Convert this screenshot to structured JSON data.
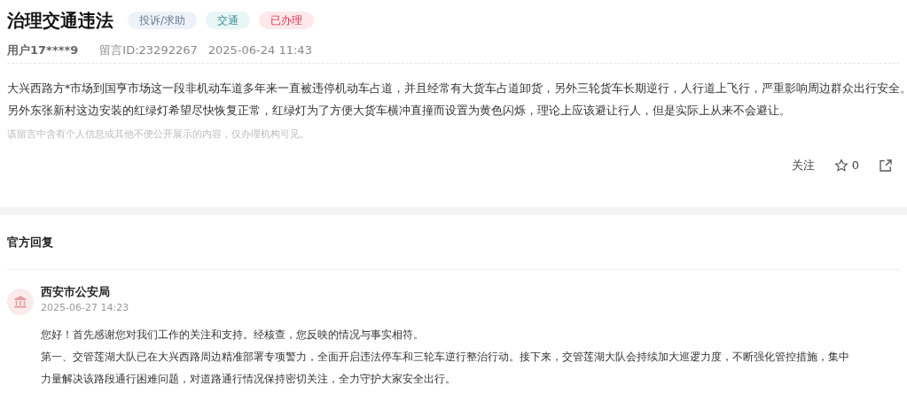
{
  "title": "治理交通违法",
  "tags": [
    {
      "label": "投诉/求助",
      "kind": "category"
    },
    {
      "label": "交通",
      "kind": "topic"
    },
    {
      "label": "已办理",
      "kind": "status"
    }
  ],
  "meta": {
    "user": "用户17****9",
    "message_id": "留言ID:23292267",
    "time": "2025-06-24 11:43"
  },
  "body_lines": [
    "大兴西路方*市场到国亨市场这一段非机动车道多年来一直被违停机动车占道，并且经常有大货车占道卸货，另外三轮货车长期逆行，人行道上飞行，严重影响周边群众出行安全。",
    "另外东张新村这边安装的红绿灯希望尽快恢复正常，红绿灯为了方便大货车横冲直撞而设置为黄色闪烁，理论上应该避让行人，但是实际上从来不会避让。"
  ],
  "privacy_note": "该留言中含有个人信息或其他不便公开展示的内容，仅办理机构可见。",
  "actions": {
    "follow": "关注",
    "star_count": "0"
  },
  "reply_heading": "官方回复",
  "reply": {
    "org": "西安市公安局",
    "time": "2025-06-27 14:23",
    "lines": [
      "您好！首先感谢您对我们工作的关注和支持。经核查，您反映的情况与事实相符。",
      "第一、交管莲湖大队已在大兴西路周边精准部署专项警力，全面开启违法停车和三轮车逆行整治行动。接下来，交管莲湖大队会持续加大巡逻力度，不断强化管控措施，集中",
      "力量解决该路段通行困难问题，对道路通行情况保持密切关注，全力守护大家安全出行。"
    ]
  }
}
